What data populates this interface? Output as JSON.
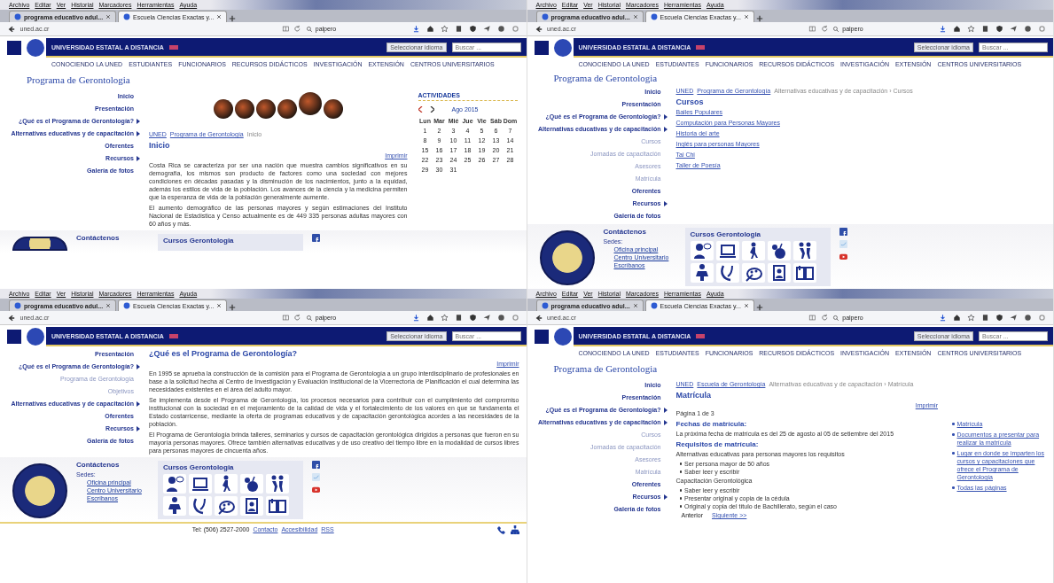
{
  "panels": [
    {
      "menu": [
        "Archivo",
        "Editar",
        "Ver",
        "Historial",
        "Marcadores",
        "Herramientas",
        "Ayuda"
      ],
      "tabs": [
        {
          "label": "programa educativo adul...",
          "selected": false
        },
        {
          "label": "Escuela Ciencias Exactas y...",
          "selected": true
        }
      ],
      "url": "uned.ac.cr",
      "search": "palpero",
      "site_name": "UNIVERSIDAD ESTATAL A DISTANCIA",
      "language_select": "Seleccionar idioma",
      "site_search_placeholder": "Buscar ...",
      "nav": [
        "CONOCIENDO LA UNED",
        "ESTUDIANTES",
        "FUNCIONARIOS",
        "RECURSOS DIDÁCTICOS",
        "INVESTIGACIÓN",
        "EXTENSIÓN",
        "CENTROS UNIVERSITARIOS"
      ],
      "title": "Programa de Gerontologia",
      "sidebar": [
        {
          "label": "Inicio",
          "submenu": false
        },
        {
          "label": "Presentación",
          "submenu": false
        },
        {
          "label": "¿Qué es el Programa de Gerontología?",
          "submenu": true
        },
        {
          "label": "Alternativas educativas y de capacitación",
          "submenu": true
        },
        {
          "label": "Oferentes",
          "submenu": false
        },
        {
          "label": "Recursos",
          "submenu": true
        },
        {
          "label": "Galería de fotos",
          "submenu": false
        }
      ],
      "blocks": [
        {
          "kind": "banner"
        },
        {
          "kind": "breadcrumb",
          "items": [
            {
              "text": "UNED",
              "link": true
            },
            {
              "text": "Programa de Gerontología",
              "link": true
            },
            {
              "text": "Inicio",
              "link": false
            }
          ]
        },
        {
          "kind": "heading",
          "text": "Inicio"
        },
        {
          "kind": "print",
          "text": "Imprimir"
        },
        {
          "kind": "paragraph",
          "text": "Costa Rica se caracteriza por ser una nación que muestra cambios significativos en su demografía, los mismos son producto de factores como una sociedad con mejores condiciones en décadas pasadas y la disminución de los nacimientos, junto a la equidad, además los estilos de vida de la población. Los avances de la ciencia y la medicina permiten que la esperanza de vida de la población generalmente aumente."
        },
        {
          "kind": "paragraph",
          "text": "El aumento demográfico de las personas mayores y según estimaciones del Instituto Nacional de Estadística y Censo actualmente es de 449 335 personas adultas mayores con 60 años y más."
        }
      ],
      "aside": {
        "kind": "calendar",
        "title": "ACTIVIDADES",
        "month": "Ago 2015",
        "weekdays": [
          "Lun",
          "Mar",
          "Mié",
          "Jue",
          "Vie",
          "Sáb",
          "Dom"
        ],
        "days": [
          "1",
          "2",
          "3",
          "4",
          "5",
          "6",
          "7",
          "8",
          "9",
          "10",
          "11",
          "12",
          "13",
          "14",
          "15",
          "16",
          "17",
          "18",
          "19",
          "20",
          "21",
          "22",
          "23",
          "24",
          "25",
          "26",
          "27",
          "28",
          "29",
          "30",
          "31"
        ]
      },
      "footer": {
        "contact_title": "Contáctenos",
        "courses_title": "Cursos Gerontologia"
      }
    },
    {
      "menu": [
        "Archivo",
        "Editar",
        "Ver",
        "Historial",
        "Marcadores",
        "Herramientas",
        "Ayuda"
      ],
      "tabs": [
        {
          "label": "programa educativo adul...",
          "selected": false
        },
        {
          "label": "Escuela Ciencias Exactas y...",
          "selected": true
        }
      ],
      "url": "uned.ac.cr",
      "search": "palpero",
      "site_name": "UNIVERSIDAD ESTATAL A DISTANCIA",
      "language_select": "Seleccionar idioma",
      "site_search_placeholder": "Buscar ...",
      "nav": [
        "CONOCIENDO LA UNED",
        "ESTUDIANTES",
        "FUNCIONARIOS",
        "RECURSOS DIDÁCTICOS",
        "INVESTIGACIÓN",
        "EXTENSIÓN",
        "CENTROS UNIVERSITARIOS"
      ],
      "title": "Programa de Gerontologia",
      "sidebar": [
        {
          "label": "Inicio",
          "submenu": false
        },
        {
          "label": "Presentación",
          "submenu": false
        },
        {
          "label": "¿Qué es el Programa de Gerontología?",
          "submenu": true
        },
        {
          "label": "Alternativas educativas y de capacitación",
          "submenu": true,
          "children": [
            {
              "label": "Cursos",
              "submenu": false
            },
            {
              "label": "Jornadas de capacitación",
              "submenu": false
            },
            {
              "label": "Asesores",
              "submenu": false
            },
            {
              "label": "Matrícula",
              "submenu": false
            }
          ]
        },
        {
          "label": "Oferentes",
          "submenu": false
        },
        {
          "label": "Recursos",
          "submenu": true
        },
        {
          "label": "Galería de fotos",
          "submenu": false
        }
      ],
      "blocks": [
        {
          "kind": "breadcrumb",
          "items": [
            {
              "text": "UNED",
              "link": true
            },
            {
              "text": "Programa de Gerontología",
              "link": true
            },
            {
              "text": "Alternativas educativas y de capacitación › Cursos",
              "link": false
            }
          ]
        },
        {
          "kind": "heading",
          "text": "Cursos"
        },
        {
          "kind": "links",
          "items": [
            "Bailes Populares",
            "Computación para Personas Mayores",
            "Historia del arte",
            "Inglés para personas Mayores",
            "Tai Chi",
            "Taller de Poesía"
          ]
        }
      ],
      "footer": {
        "contact_title": "Contáctenos",
        "sedes_label": "Sedes:",
        "links": [
          "Oficina principal",
          "Centro Universitario",
          "Escríbanos"
        ],
        "courses_title": "Cursos Gerontologia"
      }
    },
    {
      "menu": [
        "Archivo",
        "Editar",
        "Ver",
        "Historial",
        "Marcadores",
        "Herramientas",
        "Ayuda"
      ],
      "tabs": [
        {
          "label": "programa educativo adul...",
          "selected": false
        },
        {
          "label": "Escuela Ciencias Exactas y...",
          "selected": true
        }
      ],
      "url": "uned.ac.cr",
      "search": "palpero",
      "site_name": "UNIVERSIDAD ESTATAL A DISTANCIA",
      "language_select": "Seleccionar idioma",
      "site_search_placeholder": "Buscar ...",
      "sidebar": [
        {
          "label": "Presentación",
          "submenu": false
        },
        {
          "label": "¿Qué es el Programa de Gerontología?",
          "submenu": true,
          "children": [
            {
              "label": "Programa de Gerontología",
              "submenu": false
            },
            {
              "label": "Objetivos",
              "submenu": false
            }
          ]
        },
        {
          "label": "Alternativas educativas y de capacitación",
          "submenu": true
        },
        {
          "label": "Oferentes",
          "submenu": false
        },
        {
          "label": "Recursos",
          "submenu": true
        },
        {
          "label": "Galería de fotos",
          "submenu": false
        }
      ],
      "blocks": [
        {
          "kind": "heading",
          "text": "¿Qué es el Programa de Gerontología?"
        },
        {
          "kind": "print",
          "text": "Imprimir"
        },
        {
          "kind": "paragraph",
          "text": "En 1995 se aprueba la construcción de la comisión para el Programa de Gerontología a un grupo interdisciplinario de profesionales en base a la solicitud hecha al Centro de Investigación y Evaluación Institucional de la Vicerrectoría de Planificación el cual determina las necesidades existentes en el área del adulto mayor."
        },
        {
          "kind": "paragraph",
          "text": "Se implementa desde el Programa de Gerontología, los procesos necesarios para contribuir con el cumplimiento del compromiso institucional con la sociedad en el mejoramiento de la calidad de vida y el fortalecimiento de los valores en que se fundamenta el Estado costarricense, mediante la oferta de programas educativos y de capacitación gerontológica acordes a las necesidades de la población."
        },
        {
          "kind": "paragraph",
          "text": "El Programa de Gerontología brinda talleres, seminarios y cursos de capacitación gerontológica dirigidos a personas que fueron en su mayoría personas mayores. Ofrece también alternativas educativas y de uso creativo del tiempo libre en la modalidad de cursos libres para personas mayores de cincuenta años."
        }
      ],
      "footer": {
        "contact_title": "Contáctenos",
        "sedes_label": "Sedes:",
        "links": [
          "Oficina principal",
          "Centro Universitario",
          "Escríbanos"
        ],
        "courses_title": "Cursos Gerontologia"
      },
      "bottom_bar": [
        {
          "text": "Tel: (506) 2527-2000",
          "link": false
        },
        {
          "text": "Contacto",
          "link": true
        },
        {
          "text": "Accesibilidad",
          "link": true
        },
        {
          "text": "RSS",
          "link": true
        }
      ]
    },
    {
      "menu": [
        "Archivo",
        "Editar",
        "Ver",
        "Historial",
        "Marcadores",
        "Herramientas",
        "Ayuda"
      ],
      "tabs": [
        {
          "label": "programa educativo adul...",
          "selected": false
        },
        {
          "label": "Escuela Ciencias Exactas y...",
          "selected": true
        }
      ],
      "url": "uned.ac.cr",
      "search": "palpero",
      "site_name": "UNIVERSIDAD ESTATAL A DISTANCIA",
      "language_select": "Seleccionar idioma",
      "site_search_placeholder": "Buscar ...",
      "nav": [
        "CONOCIENDO LA UNED",
        "ESTUDIANTES",
        "FUNCIONARIOS",
        "RECURSOS DIDÁCTICOS",
        "INVESTIGACIÓN",
        "EXTENSIÓN",
        "CENTROS UNIVERSITARIOS"
      ],
      "title": "Programa de Gerontologia",
      "sidebar": [
        {
          "label": "Inicio",
          "submenu": false
        },
        {
          "label": "Presentación",
          "submenu": false
        },
        {
          "label": "¿Qué es el Programa de Gerontología?",
          "submenu": true
        },
        {
          "label": "Alternativas educativas y de capacitación",
          "submenu": true,
          "children": [
            {
              "label": "Cursos",
              "submenu": false
            },
            {
              "label": "Jornadas de capacitación",
              "submenu": false
            },
            {
              "label": "Asesores",
              "submenu": false
            },
            {
              "label": "Matrícula",
              "submenu": false
            }
          ]
        },
        {
          "label": "Oferentes",
          "submenu": false
        },
        {
          "label": "Recursos",
          "submenu": true
        },
        {
          "label": "Galería de fotos",
          "submenu": false
        }
      ],
      "blocks": [
        {
          "kind": "breadcrumb",
          "items": [
            {
              "text": "UNED",
              "link": true
            },
            {
              "text": "Escuela de Gerontología",
              "link": true
            },
            {
              "text": "Alternativas educativas y de capacitación › Matrícula",
              "link": false
            }
          ]
        },
        {
          "kind": "heading",
          "text": "Matrícula"
        },
        {
          "kind": "print",
          "text": "Imprimir"
        },
        {
          "kind": "note",
          "text": "Página 1 de 3"
        },
        {
          "kind": "subheading",
          "text": "Fechas de matrícula:"
        },
        {
          "kind": "note",
          "text": "La próxima fecha de matrícula es del 25 de agosto al 05 de setiembre del 2015"
        },
        {
          "kind": "subheading",
          "text": "Requisitos de matrícula:"
        },
        {
          "kind": "note",
          "text": "Alternativas educativas para personas mayores los requisitos"
        },
        {
          "kind": "bullets",
          "items": [
            "Ser persona mayor de 50 años",
            "Saber leer y escribir"
          ]
        },
        {
          "kind": "note",
          "text": "Capacitación Gerontológica"
        },
        {
          "kind": "bullets",
          "items": [
            "Saber leer y escribir",
            "Presentar original y copia de la cédula",
            "Original y copia del título de Bachillerato, según el caso"
          ]
        },
        {
          "kind": "pager",
          "items": [
            {
              "text": "Anterior",
              "link": false
            },
            {
              "text": "Siguiente >>",
              "link": true
            }
          ]
        }
      ],
      "aside": {
        "kind": "toc",
        "items": [
          "Matrícula",
          "Documentos a presentar para realizar la matrícula",
          "Lugar en donde se imparten los cursos y capacitaciones que ofrece el Programa de Gerontología",
          "Todas las páginas"
        ]
      }
    }
  ]
}
